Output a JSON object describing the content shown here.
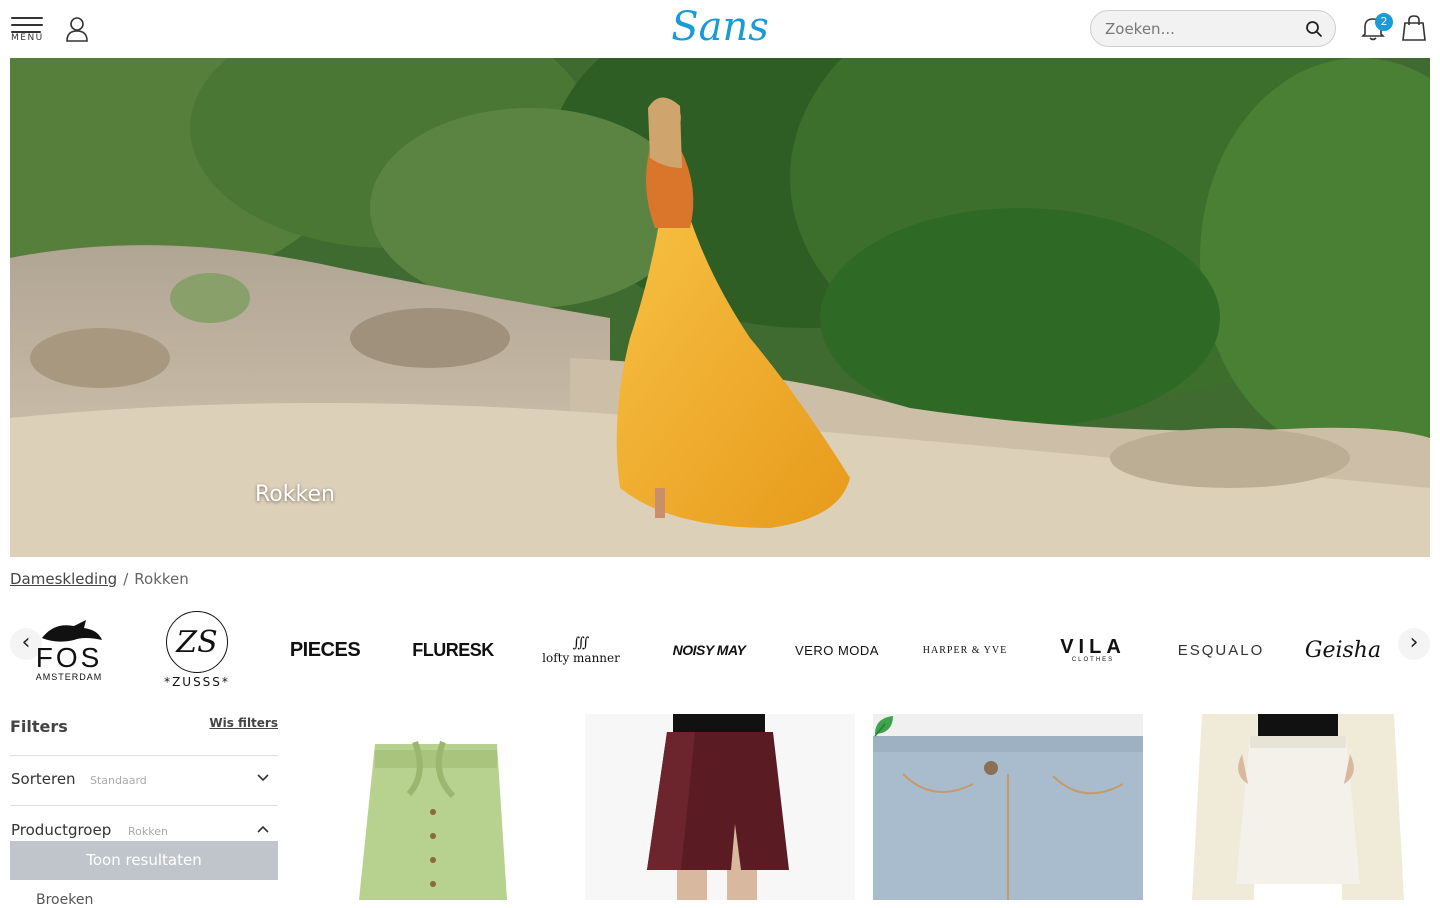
{
  "header": {
    "menu_label": "MENU",
    "logo_text": "Sans",
    "search_placeholder": "Zoeken...",
    "notification_count": "2"
  },
  "hero": {
    "title": "Rokken"
  },
  "breadcrumb": {
    "parent": "Dameskleding",
    "separator": "/",
    "current": "Rokken"
  },
  "brands": [
    {
      "name": "FOS",
      "sub": "AMSTERDAM"
    },
    {
      "name": "ZS",
      "sub": "*ZUSSS*"
    },
    {
      "name": "PIECES"
    },
    {
      "name": "FLURESK"
    },
    {
      "name": "lofty manner"
    },
    {
      "name": "NOISY MAY"
    },
    {
      "name": "VERO MODA"
    },
    {
      "name": "HARPER & YVE"
    },
    {
      "name": "VILA",
      "sub": "CLOTHES"
    },
    {
      "name": "ESQUALO"
    },
    {
      "name": "Geisha"
    }
  ],
  "filters": {
    "title": "Filters",
    "clear": "Wis filters",
    "sort_label": "Sorteren",
    "sort_value": "Standaard",
    "group_label": "Productgroep",
    "group_value": "Rokken",
    "show_results": "Toon resultaten",
    "first_option": "Broeken"
  },
  "colors": {
    "brand_blue": "#1a9bd7",
    "button_grey": "#c0c5cc"
  },
  "products": [
    {
      "name": "green-paperbag-skirt"
    },
    {
      "name": "burgundy-leather-mini-skirt"
    },
    {
      "name": "denim-skirt"
    },
    {
      "name": "white-denim-skirt"
    }
  ]
}
